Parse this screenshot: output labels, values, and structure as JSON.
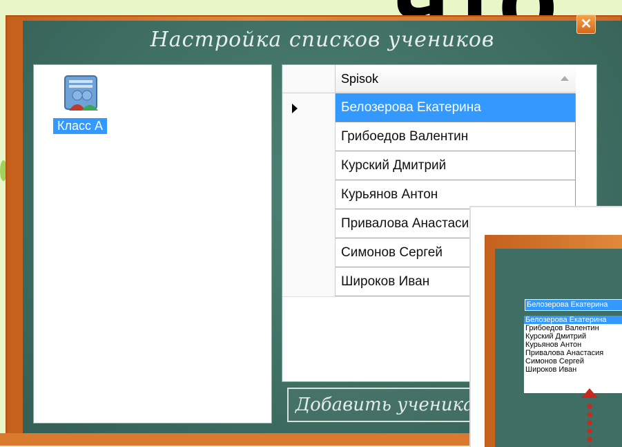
{
  "window": {
    "title": "Настройка списков учеников",
    "close_glyph": "✕"
  },
  "classes": [
    {
      "label": "Класс А",
      "icon": "users-group-icon"
    }
  ],
  "grid": {
    "column_header": "Spisok",
    "rows": [
      "Белозерова Екатерина",
      "Грибоедов Валентин",
      "Курский Дмитрий",
      "Курьянов Антон",
      "Привалова Анастасия",
      "Симонов Сергей",
      "Широков Иван"
    ],
    "selected_index": 0
  },
  "add_button": {
    "label": "Добавить ученика"
  },
  "overlay": {
    "select_value": "Белозерова Екатерина",
    "items": [
      "Белозерова Екатерина",
      "Грибоедов Валентин",
      "Курский Дмитрий",
      "Курьянов Антон",
      "Привалова Анастасия",
      "Симонов Сергей",
      "Широков Иван"
    ]
  },
  "colors": {
    "board": "#3f6f64",
    "frame": "#d9742a",
    "selection": "#3399ff",
    "arrow": "#c8281e"
  }
}
